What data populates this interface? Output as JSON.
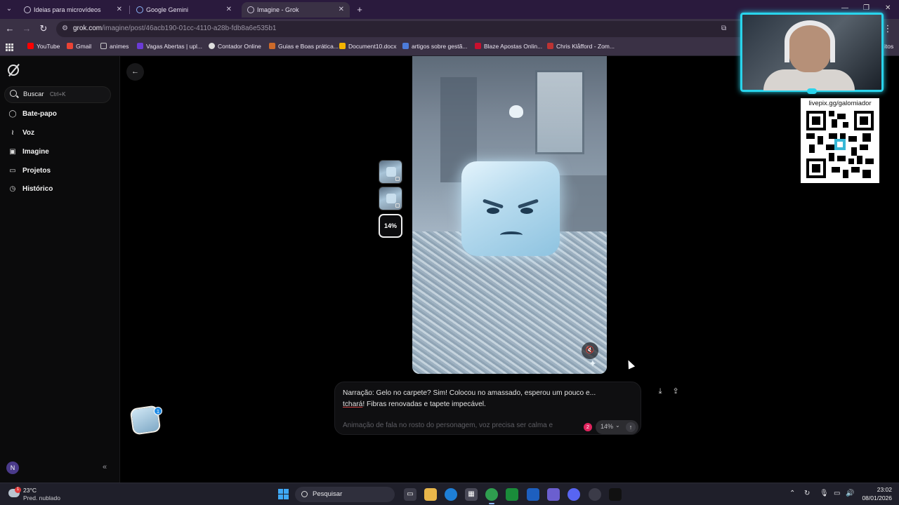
{
  "browser": {
    "tabs": [
      {
        "title": "Ideias para microvídeos"
      },
      {
        "title": "Google Gemini"
      },
      {
        "title": "Imagine - Grok"
      }
    ],
    "url_host": "grok.com",
    "url_path": "/imagine/post/46acb190-01cc-4110-a28b-fdb8a6e535b1",
    "bookmarks": [
      {
        "label": "YouTube",
        "color": "#ff0000"
      },
      {
        "label": "Gmail",
        "color": "#ea4335"
      },
      {
        "label": "animes",
        "color": "#c9c9c9"
      },
      {
        "label": "Vagas Abertas | upl...",
        "color": "#6b3bd6"
      },
      {
        "label": "Contador Online",
        "color": "#dddddd"
      },
      {
        "label": "Guias e Boas prática...",
        "color": "#cc6a2a"
      },
      {
        "label": "Document10.docx",
        "color": "#f4b400"
      },
      {
        "label": "artigos sobre gestã...",
        "color": "#4c7bd9"
      },
      {
        "label": "Blaze Apostas Onlin...",
        "color": "#c8102e"
      },
      {
        "label": "Chris Klåfford - Zom...",
        "color": "#b33"
      }
    ],
    "bookmarks_overflow": "itos"
  },
  "sidebar": {
    "search_label": "Buscar",
    "search_shortcut": "Ctrl+K",
    "items": [
      {
        "label": "Bate-papo",
        "icon": "chat-bubble-icon"
      },
      {
        "label": "Voz",
        "icon": "waveform-icon"
      },
      {
        "label": "Imagine",
        "icon": "image-icon"
      },
      {
        "label": "Projetos",
        "icon": "folder-icon"
      },
      {
        "label": "Histórico",
        "icon": "history-icon"
      }
    ],
    "user_initial": "N"
  },
  "main": {
    "progress_thumb": "14%",
    "prompt_text_a": "Narração: Gelo no carpete? Sim! Colocou no amassado, esperou um pouco e... ",
    "prompt_text_underlined": "tchará",
    "prompt_text_b": "! Fibras renovadas e tapete impecável.",
    "prompt_sub": "Animação de fala no rosto do personagem, voz precisa ser calma e",
    "notification_count": "2",
    "progress_pill": "14%",
    "floating_badge": "1"
  },
  "overlay": {
    "qr_label": "livepix.gg/galomiador"
  },
  "taskbar": {
    "temperature": "23°C",
    "weather_desc": "Pred. nublado",
    "weather_badge": "1",
    "search_label": "Pesquisar",
    "time": "23:02",
    "date": "08/01/2026"
  },
  "colors": {
    "tab_strip": "#2a1a3d",
    "accent_cyan": "#29d4ec",
    "notification": "#e0245e"
  }
}
